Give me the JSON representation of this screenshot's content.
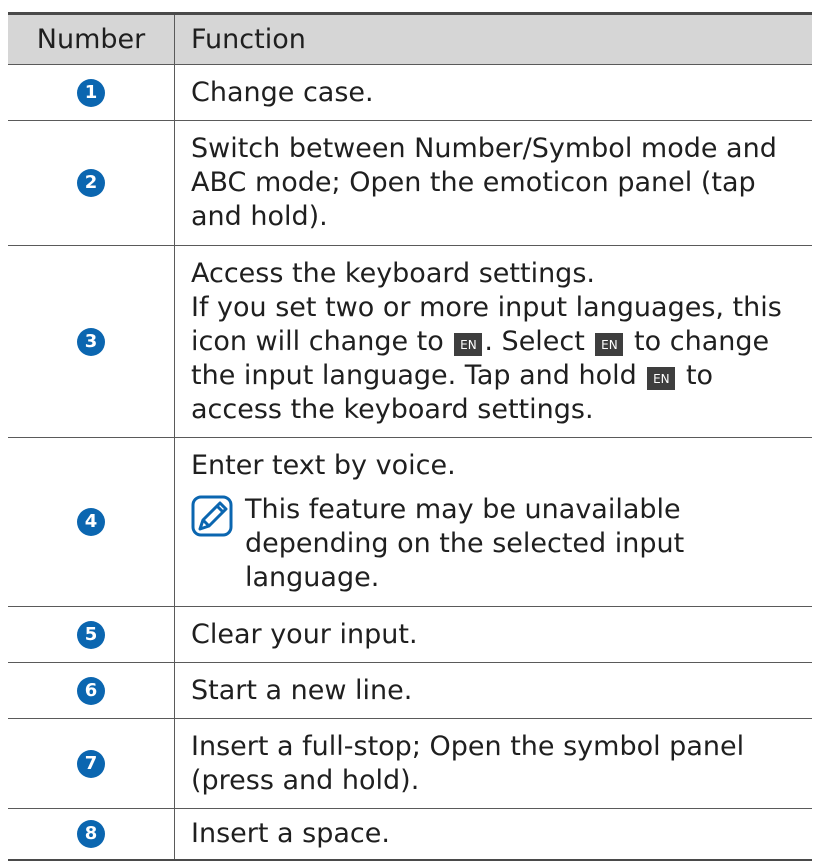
{
  "headers": {
    "number": "Number",
    "function": "Function"
  },
  "rows": [
    {
      "number": "1",
      "text": "Change case."
    },
    {
      "number": "2",
      "text": "Switch between Number/Symbol mode and ABC mode; Open the emoticon panel (tap and hold)."
    },
    {
      "number": "3",
      "line1": "Access the keyboard settings.",
      "seg1": "If you set two or more input languages, this icon will change to",
      "badge": "EN",
      "seg2": ". Select",
      "seg3": "to change the input language. Tap and hold",
      "seg4": "to access the keyboard settings."
    },
    {
      "number": "4",
      "text": "Enter text by voice.",
      "note": "This feature may be unavailable depending on the selected input language.",
      "note_icon": "note-pencil-icon"
    },
    {
      "number": "5",
      "text": "Clear your input."
    },
    {
      "number": "6",
      "text": "Start a new line."
    },
    {
      "number": "7",
      "text": "Insert a full-stop; Open the symbol panel (press and hold)."
    },
    {
      "number": "8",
      "text": "Insert a space."
    }
  ],
  "colors": {
    "badge": "#0b66b0",
    "header_bg": "#d6d6d6",
    "en_badge": "#3e3e3e"
  }
}
